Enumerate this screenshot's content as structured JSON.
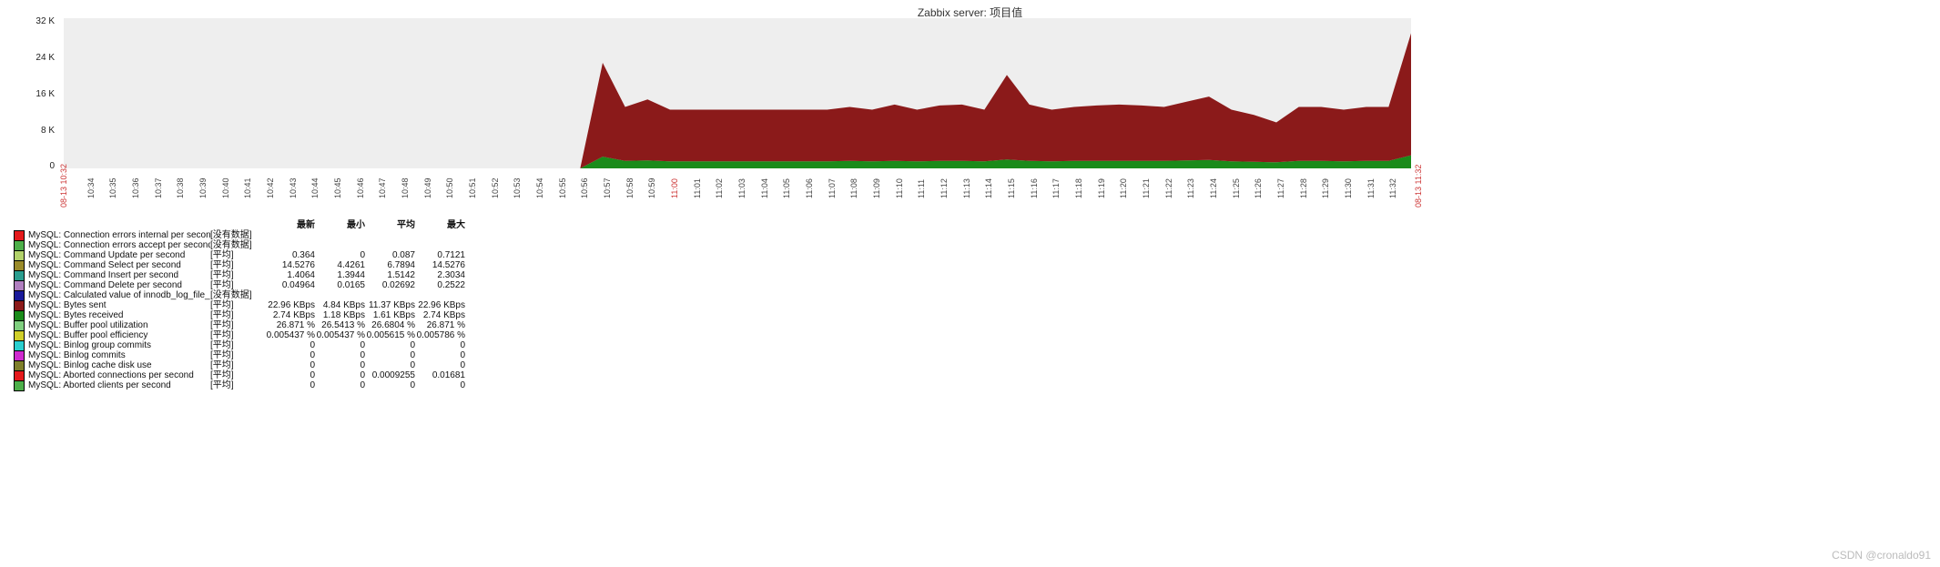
{
  "title": "Zabbix server: 项目值",
  "watermark": "CSDN @cronaldo91",
  "edges": {
    "start": "08-13 10:32",
    "end": "08-13 11:32"
  },
  "legend_headers": {
    "latest": "最新",
    "min": "最小",
    "avg": "平均",
    "max": "最大"
  },
  "legend": [
    {
      "color": "#e41a1c",
      "name": "MySQL: Connection errors internal per second",
      "type": "[没有数据]",
      "latest": "",
      "min": "",
      "avg": "",
      "max": ""
    },
    {
      "color": "#4daf4a",
      "name": "MySQL: Connection errors accept per second",
      "type": "[没有数据]",
      "latest": "",
      "min": "",
      "avg": "",
      "max": ""
    },
    {
      "color": "#b2d26a",
      "name": "MySQL: Command Update per second",
      "type": "[平均]",
      "latest": "0.364",
      "min": "0",
      "avg": "0.087",
      "max": "0.7121"
    },
    {
      "color": "#9a8b2a",
      "name": "MySQL: Command Select per second",
      "type": "[平均]",
      "latest": "14.5276",
      "min": "4.4261",
      "avg": "6.7894",
      "max": "14.5276"
    },
    {
      "color": "#2a9d8f",
      "name": "MySQL: Command Insert per second",
      "type": "[平均]",
      "latest": "1.4064",
      "min": "1.3944",
      "avg": "1.5142",
      "max": "2.3034"
    },
    {
      "color": "#b07fbf",
      "name": "MySQL: Command Delete per second",
      "type": "[平均]",
      "latest": "0.04964",
      "min": "0.0165",
      "avg": "0.02692",
      "max": "0.2522"
    },
    {
      "color": "#1a1a9a",
      "name": "MySQL: Calculated value of innodb_log_file_size",
      "type": "[没有数据]",
      "latest": "",
      "min": "",
      "avg": "",
      "max": ""
    },
    {
      "color": "#8b1a1a",
      "name": "MySQL: Bytes sent",
      "type": "[平均]",
      "latest": "22.96 KBps",
      "min": "4.84 KBps",
      "avg": "11.37 KBps",
      "max": "22.96 KBps"
    },
    {
      "color": "#1a8b1a",
      "name": "MySQL: Bytes received",
      "type": "[平均]",
      "latest": "2.74 KBps",
      "min": "1.18 KBps",
      "avg": "1.61 KBps",
      "max": "2.74 KBps"
    },
    {
      "color": "#7fcf7f",
      "name": "MySQL: Buffer pool utilization",
      "type": "[平均]",
      "latest": "26.871 %",
      "min": "26.5413 %",
      "avg": "26.6804 %",
      "max": "26.871 %"
    },
    {
      "color": "#cfcf2a",
      "name": "MySQL: Buffer pool efficiency",
      "type": "[平均]",
      "latest": "0.005437 %",
      "min": "0.005437 %",
      "avg": "0.005615 %",
      "max": "0.005786 %"
    },
    {
      "color": "#2acfcf",
      "name": "MySQL: Binlog group commits",
      "type": "[平均]",
      "latest": "0",
      "min": "0",
      "avg": "0",
      "max": "0"
    },
    {
      "color": "#cf2acf",
      "name": "MySQL: Binlog commits",
      "type": "[平均]",
      "latest": "0",
      "min": "0",
      "avg": "0",
      "max": "0"
    },
    {
      "color": "#7f7f2a",
      "name": "MySQL: Binlog cache disk use",
      "type": "[平均]",
      "latest": "0",
      "min": "0",
      "avg": "0",
      "max": "0"
    },
    {
      "color": "#e41a1c",
      "name": "MySQL: Aborted connections per second",
      "type": "[平均]",
      "latest": "0",
      "min": "0",
      "avg": "0.0009255",
      "max": "0.01681"
    },
    {
      "color": "#4daf4a",
      "name": "MySQL: Aborted clients per second",
      "type": "[平均]",
      "latest": "0",
      "min": "0",
      "avg": "0",
      "max": "0"
    }
  ],
  "chart_data": {
    "type": "area",
    "title": "Zabbix server: 项目值",
    "xlabel": "",
    "ylabel": "",
    "yticks": [
      0,
      "8 K",
      "16 K",
      "24 K",
      "32 K"
    ],
    "ylim": [
      0,
      32000
    ],
    "xticks": [
      "10:34",
      "10:35",
      "10:36",
      "10:37",
      "10:38",
      "10:39",
      "10:40",
      "10:41",
      "10:42",
      "10:43",
      "10:44",
      "10:45",
      "10:46",
      "10:47",
      "10:48",
      "10:49",
      "10:50",
      "10:51",
      "10:52",
      "10:53",
      "10:54",
      "10:55",
      "10:56",
      "10:57",
      "10:58",
      "10:59",
      "11:00",
      "11:01",
      "11:02",
      "11:03",
      "11:04",
      "11:05",
      "11:06",
      "11:07",
      "11:08",
      "11:09",
      "11:10",
      "11:11",
      "11:12",
      "11:13",
      "11:14",
      "11:15",
      "11:16",
      "11:17",
      "11:18",
      "11:19",
      "11:20",
      "11:21",
      "11:22",
      "11:23",
      "11:24",
      "11:25",
      "11:26",
      "11:27",
      "11:28",
      "11:29",
      "11:30",
      "11:31",
      "11:32"
    ],
    "x_boundary_labels": {
      "left": "08-13 10:32",
      "right": "08-13 11:32",
      "hour_mark": "11:00"
    },
    "series": [
      {
        "name": "MySQL: Bytes sent",
        "color": "#8b1a1a",
        "unit": "Bps",
        "values": [
          0,
          0,
          0,
          0,
          0,
          0,
          0,
          0,
          0,
          0,
          0,
          0,
          0,
          0,
          0,
          0,
          0,
          0,
          0,
          0,
          0,
          0,
          0,
          0,
          20000,
          11500,
          13000,
          11000,
          11000,
          11000,
          11000,
          11000,
          11000,
          11000,
          11000,
          11500,
          11000,
          12000,
          11000,
          11800,
          12000,
          11000,
          18000,
          12000,
          11000,
          11500,
          11800,
          12000,
          11800,
          11500,
          12500,
          13500,
          11000,
          10000,
          8500,
          11500,
          11500,
          11000,
          11500,
          11500,
          26000
        ]
      },
      {
        "name": "MySQL: Bytes received",
        "color": "#1a8b1a",
        "unit": "Bps",
        "values": [
          0,
          0,
          0,
          0,
          0,
          0,
          0,
          0,
          0,
          0,
          0,
          0,
          0,
          0,
          0,
          0,
          0,
          0,
          0,
          0,
          0,
          0,
          0,
          0,
          2500,
          1600,
          1700,
          1500,
          1500,
          1500,
          1500,
          1500,
          1500,
          1500,
          1500,
          1600,
          1500,
          1600,
          1500,
          1600,
          1600,
          1500,
          1900,
          1600,
          1500,
          1600,
          1600,
          1600,
          1600,
          1600,
          1700,
          1800,
          1500,
          1400,
          1300,
          1600,
          1600,
          1500,
          1600,
          1600,
          2800
        ]
      }
    ]
  }
}
